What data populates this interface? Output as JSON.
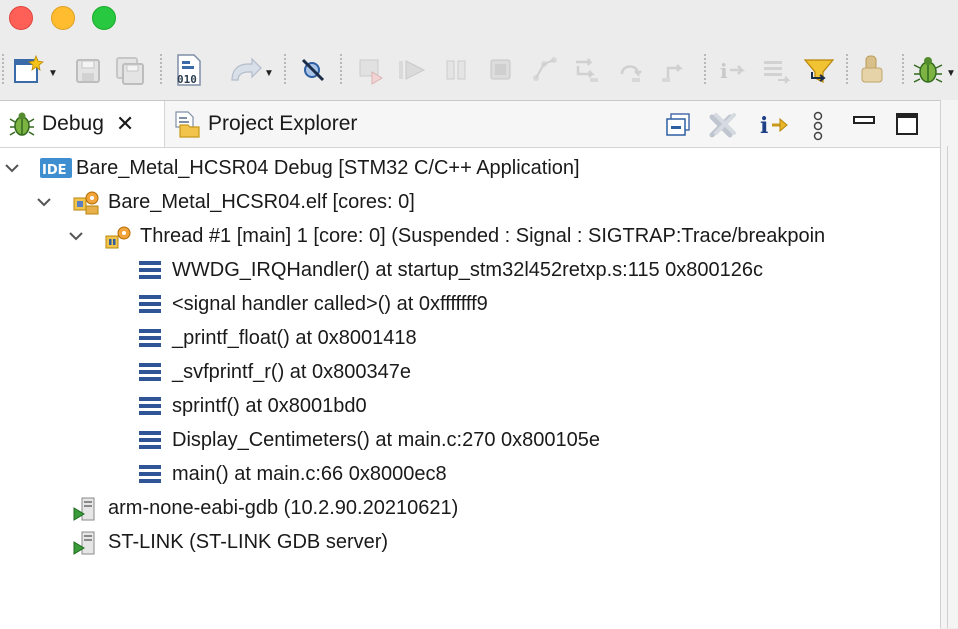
{
  "tabs": {
    "debug": {
      "label": "Debug",
      "close": "✕"
    },
    "project_explorer": {
      "label": "Project Explorer"
    }
  },
  "icons": {
    "ide_badge": "IDE"
  },
  "tree": {
    "launch": {
      "label": "Bare_Metal_HCSR04 Debug [STM32 C/C++ Application]"
    },
    "elf": {
      "label": "Bare_Metal_HCSR04.elf [cores: 0]"
    },
    "thread": {
      "label": "Thread #1 [main] 1 [core: 0] (Suspended : Signal : SIGTRAP:Trace/breakpoin"
    },
    "frames": [
      "WWDG_IRQHandler() at startup_stm32l452retxp.s:115 0x800126c",
      "<signal handler called>() at 0xfffffff9",
      "_printf_float() at 0x8001418",
      "_svfprintf_r() at 0x800347e",
      "sprintf() at 0x8001bd0",
      "Display_Centimeters() at main.c:270 0x800105e",
      "main() at main.c:66 0x8000ec8"
    ],
    "gdb": {
      "label": "arm-none-eabi-gdb (10.2.90.20210621)"
    },
    "stlink": {
      "label": "ST-LINK (ST-LINK GDB server)"
    }
  }
}
